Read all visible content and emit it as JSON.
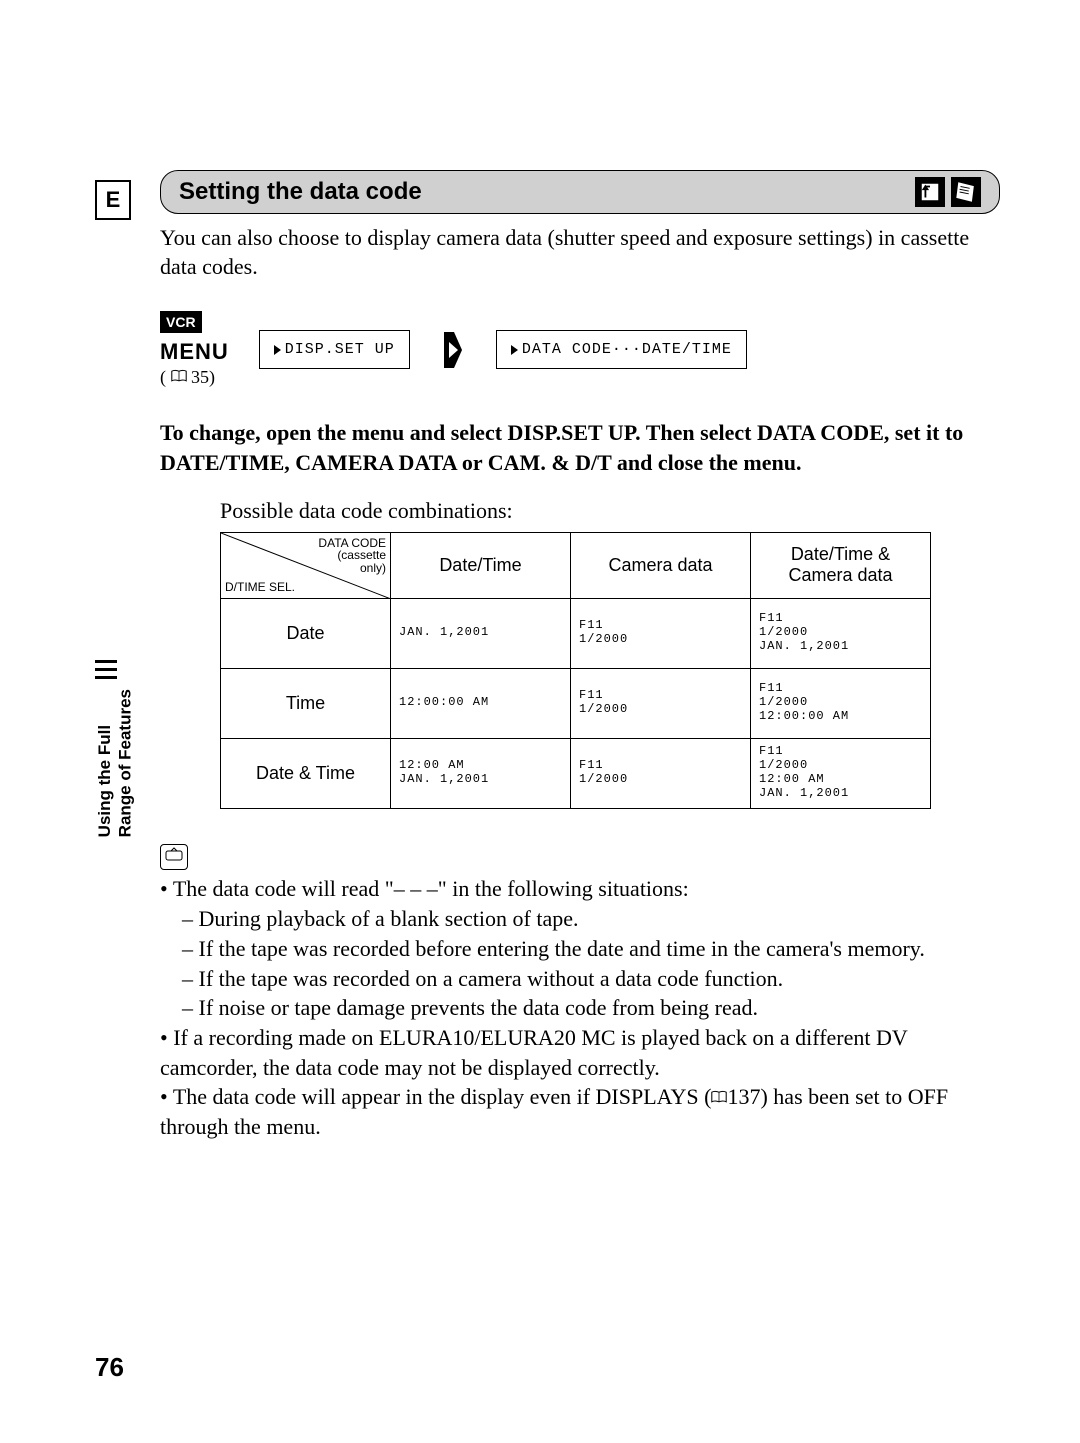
{
  "section_letter": "E",
  "section_title": "Setting the data code",
  "intro_text": "You can also choose to display camera data (shutter speed and exposure settings) in cassette data codes.",
  "vcr_badge": "VCR",
  "menu_word": "MENU",
  "menu_ref_page": "35",
  "menu_step1": "DISP.SET UP",
  "menu_step2": "DATA CODE···DATE/TIME",
  "instruction": "To change, open the menu and select DISP.SET UP. Then select DATA CODE, set it to DATE/TIME, CAMERA DATA or CAM. & D/T and close the menu.",
  "table_caption": "Possible data code combinations:",
  "table": {
    "corner_top": "DATA CODE\n(cassette\nonly)",
    "corner_bottom": "D/TIME SEL.",
    "col_headers": [
      "Date/Time",
      "Camera data",
      "Date/Time &\nCamera data"
    ],
    "row_headers": [
      "Date",
      "Time",
      "Date & Time"
    ],
    "cells": [
      [
        "JAN. 1,2001",
        "F11\n1/2000",
        "F11\n1/2000\nJAN. 1,2001"
      ],
      [
        "12:00:00 AM",
        "F11\n1/2000",
        "F11\n1/2000\n12:00:00 AM"
      ],
      [
        "12:00 AM\nJAN. 1,2001",
        "F11\n1/2000",
        "F11\n1/2000\n12:00 AM\nJAN. 1,2001"
      ]
    ]
  },
  "sidebar_text": "Using the Full\nRange of Features",
  "notes": {
    "b1": "The data code will read \"– – –\" in the following situations:",
    "b1_subs": [
      "During playback of a blank section of tape.",
      "If the tape was recorded before entering the date and time in the camera's memory.",
      "If the tape was recorded on a camera without a data code function.",
      "If noise or tape damage prevents the data code from being read."
    ],
    "b2": "If a recording made on ELURA10/ELURA20 MC is played back on a different DV camcorder, the data code may not be displayed correctly.",
    "b3_pre": "The data code will appear in the display even if DISPLAYS (",
    "b3_page": "137",
    "b3_post": ") has been set to OFF through the menu."
  },
  "page_number": "76"
}
